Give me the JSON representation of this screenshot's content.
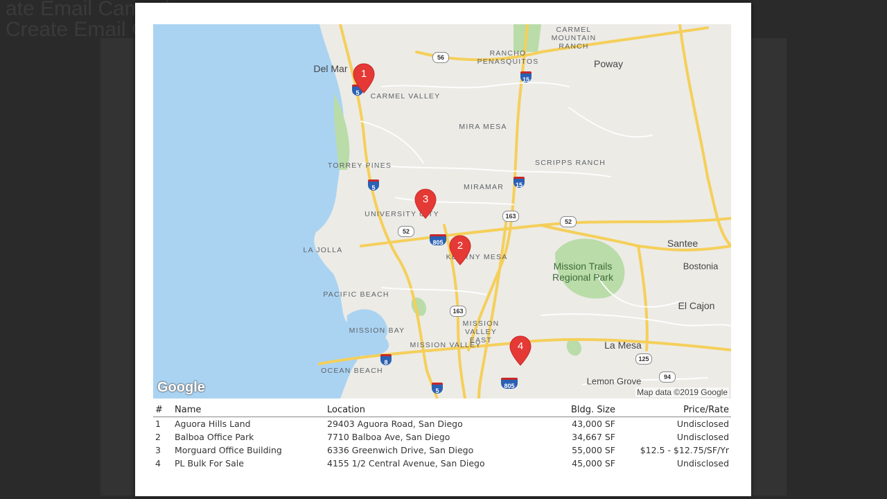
{
  "background": {
    "line1": "ate Email Campaign",
    "line2": "Create Email Campaign"
  },
  "map": {
    "attribution": "Map data ©2019 Google",
    "logo": "Google",
    "labels_small": [
      {
        "text": "CARMEL MOUNTAIN RANCH"
      },
      {
        "text": "RANCHO PENASQUITOS"
      },
      {
        "text": "CARMEL VALLEY"
      },
      {
        "text": "MIRA MESA"
      },
      {
        "text": "TORREY PINES"
      },
      {
        "text": "SCRIPPS RANCH"
      },
      {
        "text": "MIRAMAR"
      },
      {
        "text": "UNIVERSITY CITY"
      },
      {
        "text": "LA JOLLA"
      },
      {
        "text": "KEARNY MESA"
      },
      {
        "text": "PACIFIC BEACH"
      },
      {
        "text": "MISSION BAY"
      },
      {
        "text": "MISSION VALLEY EAST"
      },
      {
        "text": "MISSION VALLEY"
      },
      {
        "text": "OCEAN BEACH"
      }
    ],
    "labels_big": [
      {
        "text": "Del Mar"
      },
      {
        "text": "Poway"
      },
      {
        "text": "Santee"
      },
      {
        "text": "Bostonia"
      },
      {
        "text": "El Cajon"
      },
      {
        "text": "La Mesa"
      },
      {
        "text": "Lemon Grove"
      }
    ],
    "park": "Mission Trails Regional Park",
    "shields_interstate": [
      "5",
      "15",
      "5",
      "15",
      "805",
      "8",
      "5",
      "805"
    ],
    "shields_state": [
      "56",
      "52",
      "163",
      "52",
      "163",
      "125",
      "94"
    ],
    "markers": [
      "1",
      "2",
      "3",
      "4"
    ]
  },
  "table": {
    "headers": {
      "num": "#",
      "name": "Name",
      "location": "Location",
      "size": "Bldg. Size",
      "price": "Price/Rate"
    },
    "rows": [
      {
        "num": "1",
        "name": "Aguora Hills Land",
        "location": "29403 Aguora Road, San Diego",
        "size": "43,000 SF",
        "price": "Undisclosed"
      },
      {
        "num": "2",
        "name": "Balboa Office Park",
        "location": "7710 Balboa Ave, San Diego",
        "size": "34,667 SF",
        "price": "Undisclosed"
      },
      {
        "num": "3",
        "name": "Morguard Office Building",
        "location": "6336 Greenwich Drive, San Diego",
        "size": "55,000 SF",
        "price": "$12.5 - $12.75/SF/Yr"
      },
      {
        "num": "4",
        "name": "PL Bulk For Sale",
        "location": "4155 1/2 Central Avenue, San Diego",
        "size": "45,000 SF",
        "price": "Undisclosed"
      }
    ]
  },
  "colors": {
    "water": "#aad3f2",
    "land": "#ecebe6",
    "highway": "#f7d86a",
    "park": "#b9dca8",
    "marker": "#e53935"
  }
}
